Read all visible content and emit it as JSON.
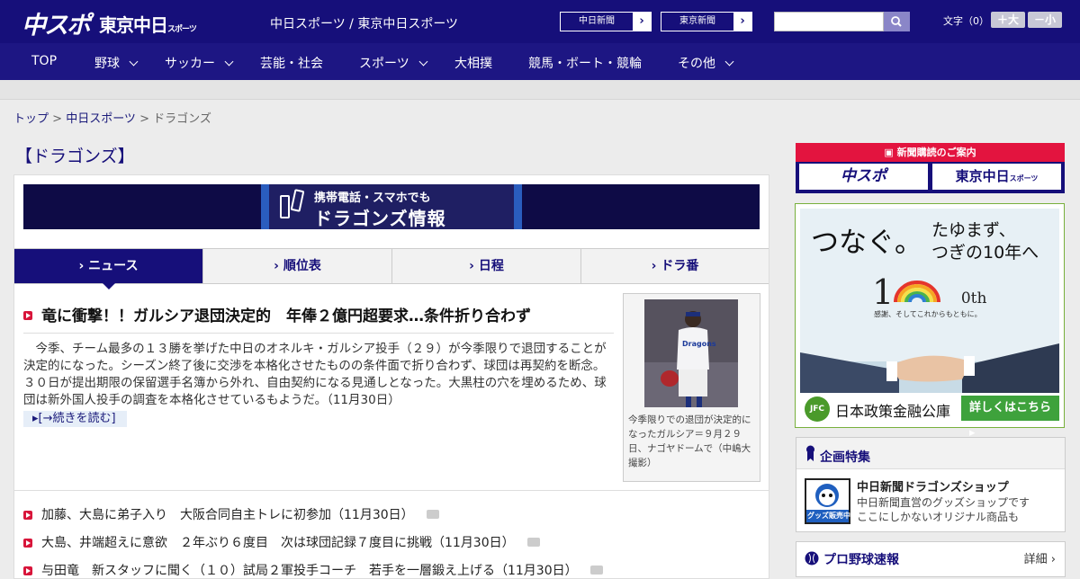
{
  "header": {
    "logo_chunichi_sports": "中スポ",
    "logo_tokyo_chunichi": "東京中日",
    "logo_tokyo_small": "スポーツ",
    "tagline": "中日スポーツ / 東京中日スポーツ",
    "pill_chunichi": "中日新聞",
    "pill_tokyo": "東京新聞",
    "search_placeholder": "",
    "font_size_label": "文字（0）",
    "font_larger": "＋大",
    "font_smaller": "－小"
  },
  "nav": {
    "items": [
      {
        "label": "TOP",
        "dropdown": false
      },
      {
        "label": "野球",
        "dropdown": true
      },
      {
        "label": "サッカー",
        "dropdown": true
      },
      {
        "label": "芸能・社会",
        "dropdown": false
      },
      {
        "label": "スポーツ",
        "dropdown": true
      },
      {
        "label": "大相撲",
        "dropdown": false
      },
      {
        "label": "競馬・ボート・競輪",
        "dropdown": false
      },
      {
        "label": "その他",
        "dropdown": true
      }
    ]
  },
  "breadcrumb": {
    "top": "トップ",
    "sep": " > ",
    "parent": "中日スポーツ",
    "current": "ドラゴンズ"
  },
  "section_title": "【ドラゴンズ】",
  "banner": {
    "line1": "携帯電話・スマホでも",
    "line2": "ドラゴンズ情報"
  },
  "tabs": [
    {
      "label": "ニュース",
      "active": true
    },
    {
      "label": "順位表",
      "active": false
    },
    {
      "label": "日程",
      "active": false
    },
    {
      "label": "ドラ番",
      "active": false
    }
  ],
  "lead": {
    "headline": "竜に衝撃！！ガルシア退団決定的　年俸２億円超要求…条件折り合わず",
    "body": "　今季、チーム最多の１３勝を挙げた中日のオネルキ・ガルシア投手（２９）が今季限りで退団することが決定的になった。シーズン終了後に交渉を本格化させたものの条件面で折り合わず、球団は再契約を断念。３０日が提出期限の保留選手名簿から外れ、自由契約になる見通しとなった。大黒柱の穴を埋めるため、球団は新外国人投手の調査を本格化させているもようだ。（11月30日）",
    "more": "[→続きを読む]",
    "photo_caption": "今季限りでの退団が決定的になったガルシア＝９月２９日、ナゴヤドームで（中嶋大撮影）"
  },
  "news_list": [
    {
      "text": "加藤、大島に弟子入り　大阪合同自主トレに初参加（11月30日）",
      "photo": true
    },
    {
      "text": "大島、井端超えに意欲　２年ぶり６度目　次は球団記録７度目に挑戦（11月30日）",
      "photo": true
    },
    {
      "text": "与田竜　新スタッフに聞く（１０）試局２軍投手コーチ　若手を一層鍛え上げる（11月30日）",
      "photo": true
    }
  ],
  "sidebar": {
    "subscribe_title": "新聞購読のご案内",
    "subscribe_chunichi_sports": "中スポ",
    "subscribe_tokyo": "東京中日",
    "subscribe_tokyo_small": "スポーツ",
    "ad_headline": "つなぐ。",
    "ad_line1": "たゆまず、",
    "ad_line2": "つぎの10年へ",
    "ad_10th": "10th",
    "ad_tagline": "感謝、そしてこれからもともに。",
    "ad_logo": "JFC",
    "ad_org": "日本政策金融公庫",
    "ad_button": "詳しくはこちら",
    "feature_title": "企画特集",
    "shop_badge": "グッズ販売中",
    "shop_title": "中日新聞ドラゴンズショップ",
    "shop_desc1": "中日新聞直営のグッズショップです",
    "shop_desc2": "ここにしかないオリジナル商品も",
    "flash_title": "プロ野球速報",
    "flash_more": "詳細 ›"
  },
  "colors": {
    "brand_navy": "#160f7a",
    "accent_red": "#d8153a",
    "ad_green": "#3ea23c"
  }
}
